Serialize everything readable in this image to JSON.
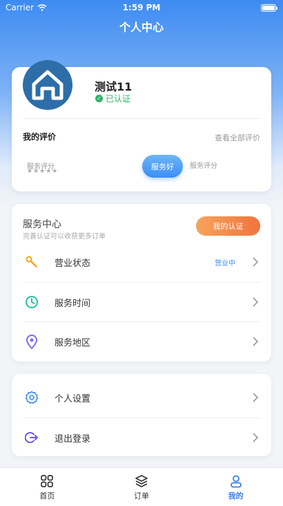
{
  "status_bar": {
    "carrier": "Carrier",
    "time": "1:59 PM"
  },
  "nav": {
    "title": "个人中心"
  },
  "profile": {
    "name": "测试11",
    "verified_label": "已认证",
    "evaluation_title": "我的评价",
    "view_all_label": "查看全部评价",
    "service_score_label_left": "服务评分",
    "stars": "★★★★★",
    "tag_label": "服务好",
    "service_score_label_right": "服务评分"
  },
  "service_center": {
    "title": "服务中心",
    "subtitle": "完善认证可以收获更多订单",
    "cert_button": "我的认证",
    "items": [
      {
        "label": "营业状态",
        "value": "营业中",
        "icon": "wrench-icon",
        "color": "#f5a623"
      },
      {
        "label": "服务时间",
        "value": "",
        "icon": "clock-icon",
        "color": "#27c39f"
      },
      {
        "label": "服务地区",
        "value": "",
        "icon": "location-pin-icon",
        "color": "#7b6cf6"
      }
    ]
  },
  "settings": {
    "items": [
      {
        "label": "个人设置",
        "icon": "gear-icon",
        "color": "#3c8ef3"
      },
      {
        "label": "退出登录",
        "icon": "logout-icon",
        "color": "#6a5cf0"
      }
    ]
  },
  "tabbar": {
    "tabs": [
      {
        "label": "首页",
        "icon": "grid-icon"
      },
      {
        "label": "订单",
        "icon": "layers-icon"
      },
      {
        "label": "我的",
        "icon": "user-icon",
        "active": true
      }
    ]
  },
  "colors": {
    "accent": "#3c8ef3",
    "verified": "#2fb36b",
    "cert_button": "#f0743e"
  }
}
